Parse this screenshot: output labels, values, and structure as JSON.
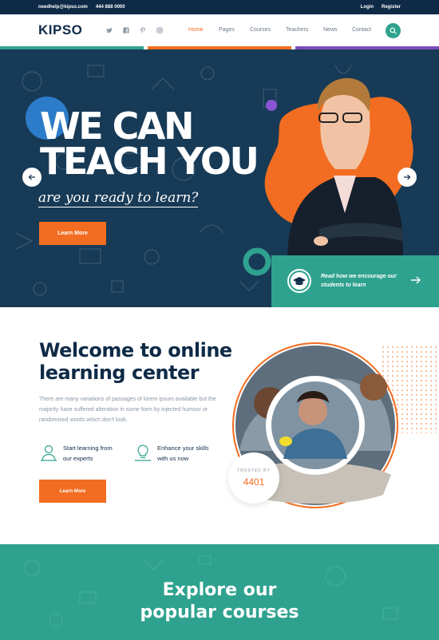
{
  "topbar": {
    "email": "needhelp@kipso.com",
    "phone": "444 888 0000",
    "login": "Login",
    "register": "Register"
  },
  "header": {
    "logo": "KIPSO",
    "social_icons": [
      "twitter-icon",
      "facebook-icon",
      "pinterest-icon",
      "instagram-icon"
    ],
    "nav": [
      "Home",
      "Pages",
      "Courses",
      "Teachers",
      "News",
      "Contact"
    ],
    "active_nav": "Home",
    "search_icon": "search-icon"
  },
  "hero": {
    "title_line1": "WE CAN",
    "title_line2": "TEACH YOU",
    "subtitle": "are you ready to learn?",
    "button": "Learn More",
    "promo_line1": "Read how we encourage our",
    "promo_line2": "students to learn"
  },
  "welcome": {
    "title_line1": "Welcome to online",
    "title_line2": "learning center",
    "paragraph": "There are many variations of passages of lorem ipsum available but the majority have suffered alteration in some form by injected humour or randomised words which don't look.",
    "feature1_line1": "Start learning from",
    "feature1_line2": "our experts",
    "feature2_line1": "Enhance your skills",
    "feature2_line2": "with us now",
    "button": "Learn More",
    "trusted_label": "TRUSTED BY",
    "trusted_value": "4401"
  },
  "courses": {
    "title_line1": "Explore our",
    "title_line2": "popular courses"
  },
  "colors": {
    "navy": "#0e2a47",
    "orange": "#f26d21",
    "teal": "#2fa28f",
    "purple": "#7c4dbd",
    "hero_bg": "#173a56"
  }
}
